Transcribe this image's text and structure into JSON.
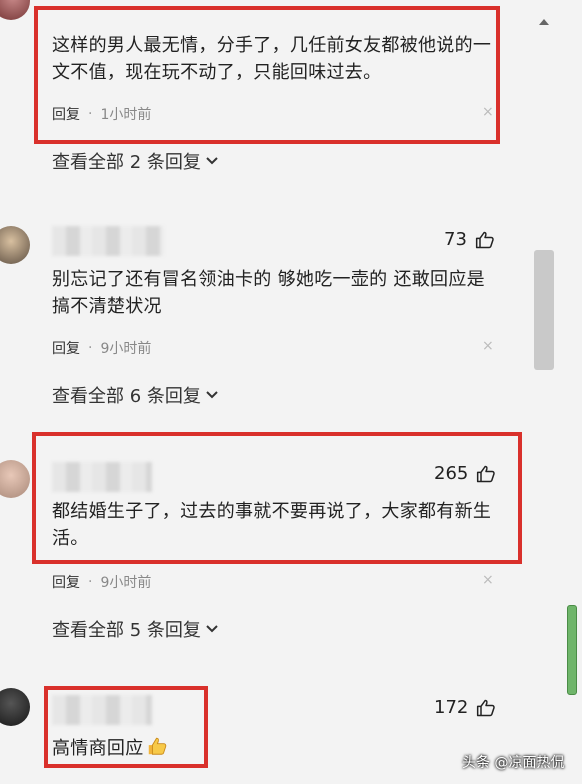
{
  "comments": [
    {
      "text": "这样的男人最无情，分手了，几任前女友都被他说的一文不值，现在玩不动了，只能回味过去。",
      "reply_label": "回复",
      "dot": "·",
      "time": "1小时前",
      "close": "×",
      "view_all": "查看全部 2 条回复"
    },
    {
      "likes": "73",
      "text": "别忘记了还有冒名领油卡的 够她吃一壶的 还敢回应是搞不清楚状况",
      "reply_label": "回复",
      "dot": "·",
      "time": "9小时前",
      "close": "×",
      "view_all": "查看全部 6 条回复"
    },
    {
      "likes": "265",
      "text": "都结婚生子了，过去的事就不要再说了，大家都有新生活。",
      "reply_label": "回复",
      "dot": "·",
      "time": "9小时前",
      "close": "×",
      "view_all": "查看全部 5 条回复"
    },
    {
      "likes": "172",
      "text": "高情商回应"
    }
  ],
  "watermark": "头条 @凉面热侃",
  "colors": {
    "highlight_box": "#d9302b",
    "background": "#f3f3f3"
  },
  "icons": {
    "like": "thumbs-up-outline-icon",
    "emoji": "thumbs-up-emoji-icon",
    "expand": "chevron-down-icon",
    "dismiss": "close-icon"
  }
}
